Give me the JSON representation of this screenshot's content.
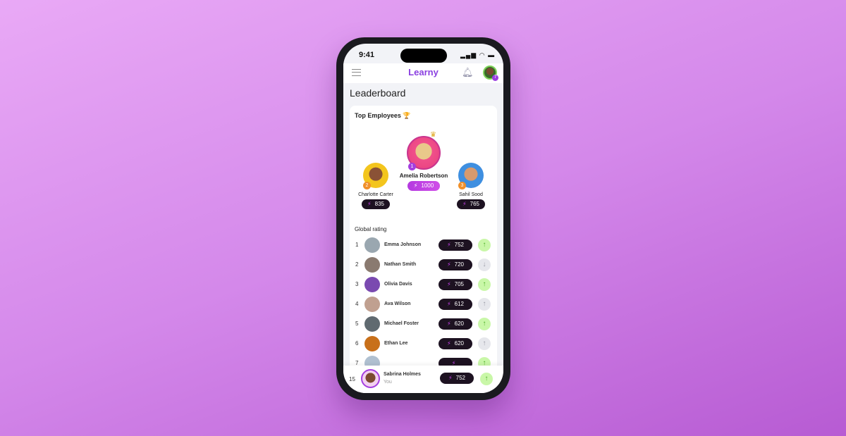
{
  "status": {
    "time": "9:41",
    "icons": "signal wifi battery"
  },
  "header": {
    "logo": "Learny",
    "menu_icon": "hamburger-icon",
    "notification_icon": "bell-icon",
    "avatar_badge": "7"
  },
  "page_title": "Leaderboard",
  "top": {
    "title": "Top Employees",
    "trophy": "🏆",
    "first": {
      "rank": "1",
      "name": "Amelia Robertson",
      "points": "1000"
    },
    "second": {
      "rank": "2",
      "name": "Charlotte Carter",
      "points": "835"
    },
    "third": {
      "rank": "3",
      "name": "Sahil Sood",
      "points": "765"
    }
  },
  "global": {
    "title": "Global rating",
    "rows": [
      {
        "rank": "1",
        "name": "Emma Johnson",
        "points": "752",
        "trend": "up"
      },
      {
        "rank": "2",
        "name": "Nathan Smith",
        "points": "720",
        "trend": "down"
      },
      {
        "rank": "3",
        "name": "Olivia Davis",
        "points": "705",
        "trend": "up"
      },
      {
        "rank": "4",
        "name": "Ava Wilson",
        "points": "612",
        "trend": "neutral-up"
      },
      {
        "rank": "5",
        "name": "Michael Foster",
        "points": "620",
        "trend": "up"
      },
      {
        "rank": "6",
        "name": "Ethan Lee",
        "points": "620",
        "trend": "neutral-up"
      },
      {
        "rank": "7",
        "name": "",
        "points": "",
        "trend": "up"
      }
    ]
  },
  "me": {
    "rank": "15",
    "name": "Sabrina Holmes",
    "subtitle": "You",
    "points": "752",
    "trend": "up"
  },
  "colors": {
    "accent": "#8a3fe0",
    "pill": "#1d1221",
    "bolt": "#c23ee6",
    "up": "#c9f7a8"
  }
}
